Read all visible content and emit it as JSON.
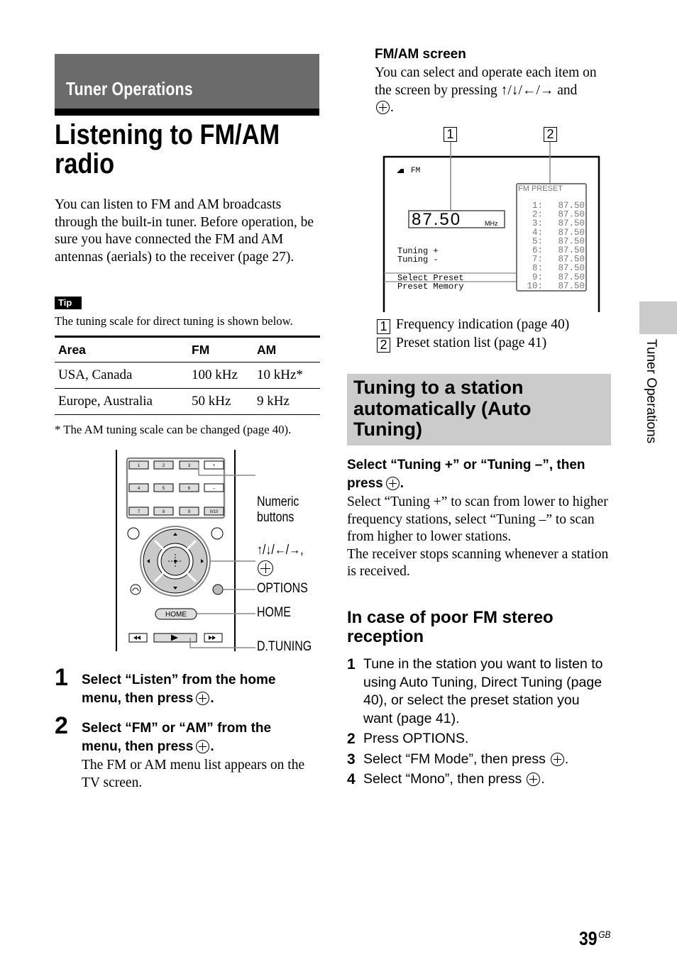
{
  "section_banner": "Tuner Operations",
  "page_title_line1": "Listening to FM/AM",
  "page_title_line2": "radio",
  "intro": "You can listen to FM and AM broadcasts through the built-in tuner. Before operation, be sure you have connected the FM and AM antennas (aerials) to the receiver (page 27).",
  "tip": {
    "badge": "Tip",
    "text": "The tuning scale for direct tuning is shown below."
  },
  "tuning_table": {
    "headers": [
      "Area",
      "FM",
      "AM"
    ],
    "rows": [
      [
        "USA, Canada",
        "100 kHz",
        "10 kHz*"
      ],
      [
        "Europe, Australia",
        "50 kHz",
        "9 kHz"
      ]
    ],
    "footnote": "*  The AM tuning scale can be changed (page 40)."
  },
  "remote": {
    "buttons": {
      "num1": "1",
      "num2": "2",
      "num3": "3",
      "plus": "+",
      "num4": "4",
      "num5": "5",
      "num6": "6",
      "minus": "–",
      "num7": "7",
      "num8": "8",
      "num9": "9",
      "num10": "0/10",
      "home": "HOME"
    },
    "labels": {
      "numeric_line1": "Numeric",
      "numeric_line2": "buttons",
      "arrows": "↑/↓/←/→,",
      "options": "OPTIONS",
      "home": "HOME",
      "dtuning": "D.TUNING"
    }
  },
  "steps": [
    {
      "number": "1",
      "line1": "Select “Listen” from the home",
      "line2": "menu, then press",
      "end": "."
    },
    {
      "number": "2",
      "line1": "Select “FM” or “AM” from the",
      "line2": "menu, then press",
      "end": ".",
      "desc": "The FM or AM menu list appears on the TV screen."
    }
  ],
  "fmam_screen": {
    "heading": "FM/AM screen",
    "desc_part1": "You can select and operate each item on the screen by pressing ↑/↓/←/→ and",
    "desc_end": ".",
    "callouts": [
      "1",
      "2"
    ],
    "band": "FM",
    "frequency": "87.50",
    "unit": "MHz",
    "menu": [
      "Tuning +",
      "Tuning -",
      "Select Preset",
      "Preset Memory"
    ],
    "preset_title": "FM PRESET",
    "presets": [
      {
        "n": "1:",
        "f": "87.50"
      },
      {
        "n": "2:",
        "f": "87.50"
      },
      {
        "n": "3:",
        "f": "87.50"
      },
      {
        "n": "4:",
        "f": "87.50"
      },
      {
        "n": "5:",
        "f": "87.50"
      },
      {
        "n": "6:",
        "f": "87.50"
      },
      {
        "n": "7:",
        "f": "87.50"
      },
      {
        "n": "8:",
        "f": "87.50"
      },
      {
        "n": "9:",
        "f": "87.50"
      },
      {
        "n": "10:",
        "f": "87.50"
      }
    ],
    "legend": [
      {
        "num": "1",
        "text": "Frequency indication (page 40)"
      },
      {
        "num": "2",
        "text": "Preset station list (page 41)"
      }
    ]
  },
  "auto_tuning": {
    "banner_line1": "Tuning to a station",
    "banner_line2": "automatically (Auto",
    "banner_line3": "Tuning)",
    "instruction_line1": "Select “Tuning +” or “Tuning –”, then",
    "instruction_line2": "press",
    "instruction_end": ".",
    "desc1": "Select “Tuning +” to scan from lower to higher frequency stations, select “Tuning –” to scan from higher to lower stations.",
    "desc2": "The receiver stops scanning whenever a station is received."
  },
  "poor_reception": {
    "heading_line1": "In case of poor FM stereo",
    "heading_line2": "reception",
    "steps": [
      {
        "num": "1",
        "text": "Tune in the station you want to listen to using Auto Tuning, Direct Tuning (page 40), or select the preset station you want (page 41)."
      },
      {
        "num": "2",
        "text": "Press OPTIONS."
      },
      {
        "num": "3",
        "text": "Select “FM Mode”, then press",
        "end": "."
      },
      {
        "num": "4",
        "text": "Select “Mono”, then press",
        "end": "."
      }
    ]
  },
  "side_tab": "Tuner Operations",
  "page_number": "39",
  "page_suffix": "GB"
}
